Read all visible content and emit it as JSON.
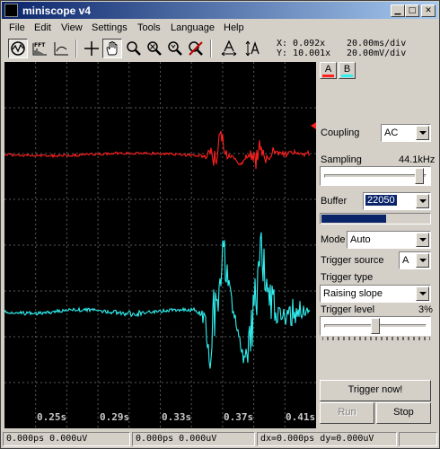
{
  "window": {
    "title": "miniscope v4"
  },
  "menu": [
    "File",
    "Edit",
    "View",
    "Settings",
    "Tools",
    "Language",
    "Help"
  ],
  "toolbar": {
    "icons": [
      "scope-view-icon",
      "fft-icon",
      "xy-icon",
      "crosshair-icon",
      "hand-icon",
      "zoom-icon",
      "zoom-out-icon",
      "zoom-fit-icon",
      "no-zoom-icon",
      "scale-x-icon",
      "scale-y-icon"
    ],
    "fft_label": "FFT",
    "cursor_x": "X: 0.092x",
    "cursor_y": "Y: 10.001x",
    "time_div": "20.00ms/div",
    "volt_div": "20.00mV/div"
  },
  "scope": {
    "time_labels": [
      "0.25s",
      "0.29s",
      "0.33s",
      "0.37s",
      "0.41s"
    ],
    "colors": {
      "channel_a": "#ff2020",
      "channel_b": "#30f0f0",
      "grid": "#5a5a5a"
    }
  },
  "side": {
    "channel_a": "A",
    "channel_b": "B",
    "coupling_label": "Coupling",
    "coupling_value": "AC",
    "sampling_label": "Sampling",
    "sampling_value": "44.1kHz",
    "sampling_level": 0.95,
    "buffer_label": "Buffer",
    "buffer_value": "22050",
    "buffer_fill": 0.6,
    "mode_label": "Mode",
    "mode_value": "Auto",
    "trigger_source_label": "Trigger source",
    "trigger_source_value": "A",
    "trigger_type_label": "Trigger type",
    "trigger_type_value": "Raising slope",
    "trigger_level_label": "Trigger level",
    "trigger_level_value": "3%",
    "trigger_level": 0.5,
    "trigger_now": "Trigger now!",
    "run": "Run",
    "stop": "Stop"
  },
  "status": {
    "panel1": "0.000ps 0.000uV",
    "panel2": "0.000ps 0.000uV",
    "panel3": "dx=0.000ps dy=0.000uV"
  }
}
